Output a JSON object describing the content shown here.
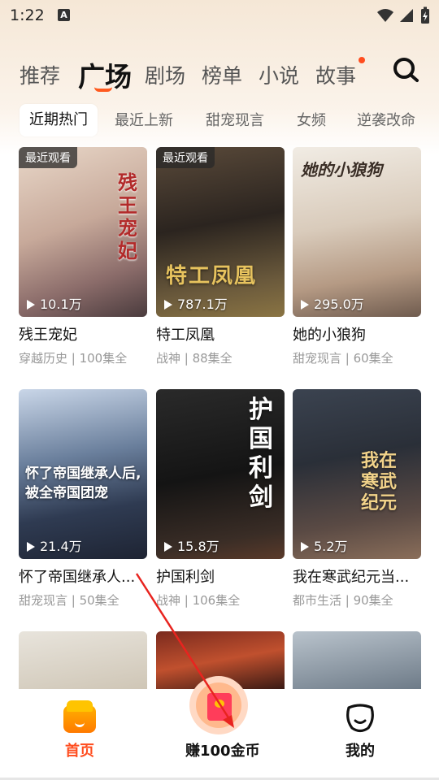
{
  "status": {
    "time": "1:22",
    "notif_icon": "A"
  },
  "tabs": [
    {
      "label": "推荐"
    },
    {
      "label": "广场"
    },
    {
      "label": "剧场"
    },
    {
      "label": "榜单"
    },
    {
      "label": "小说"
    },
    {
      "label": "故事"
    }
  ],
  "chips": [
    {
      "label": "近期热门"
    },
    {
      "label": "最近上新"
    },
    {
      "label": "甜宠现言"
    },
    {
      "label": "女频"
    },
    {
      "label": "逆袭改命"
    }
  ],
  "cards": [
    {
      "badge": "最近观看",
      "plays": "10.1万",
      "title": "残王宠妃",
      "meta": "穿越历史 | 100集全",
      "poster_text": "残王宠妃"
    },
    {
      "badge": "最近观看",
      "plays": "787.1万",
      "title": "特工凤凰",
      "meta": "战神 | 88集全",
      "poster_text": "特工凤凰"
    },
    {
      "plays": "295.0万",
      "title": "她的小狼狗",
      "meta": "甜宠现言 | 60集全",
      "poster_text": "她的小狼狗"
    },
    {
      "plays": "21.4万",
      "title": "怀了帝国继承人...",
      "meta": "甜宠现言 | 50集全",
      "poster_text": "怀了帝国继承人后, 被全帝国团宠"
    },
    {
      "plays": "15.8万",
      "title": "护国利剑",
      "meta": "战神 | 106集全",
      "poster_text": "护国利剑"
    },
    {
      "plays": "5.2万",
      "title": "我在寒武纪元当...",
      "meta": "都市生活 | 90集全",
      "poster_text": "我在寒武纪元"
    }
  ],
  "bottom_nav": {
    "home": "首页",
    "earn": "赚100金币",
    "me": "我的"
  },
  "colors": {
    "accent": "#ff5a1f",
    "active_nav": "#ff4d1f"
  }
}
